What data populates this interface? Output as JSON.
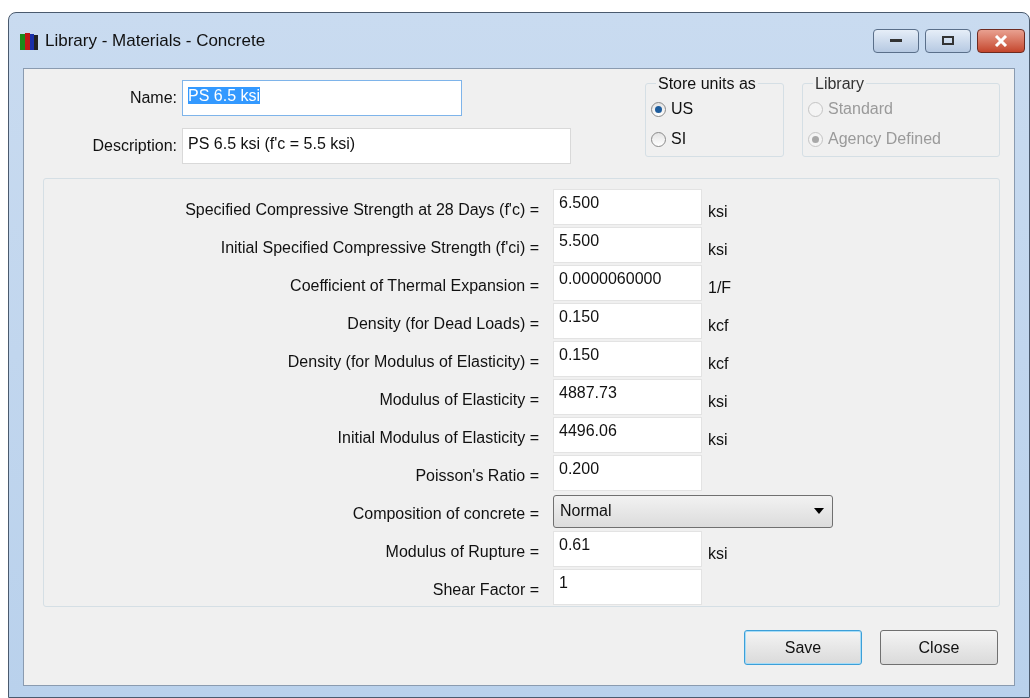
{
  "window": {
    "title": "Library - Materials - Concrete"
  },
  "header_fields": [
    {
      "label": "Name:",
      "value": "PS 6.5 ksi",
      "text_highlighted": true,
      "focused": true
    },
    {
      "label": "Description:",
      "value": "PS 6.5 ksi (f'c = 5.5 ksi)",
      "text_highlighted": false,
      "focused": false
    }
  ],
  "store_units": {
    "title": "Store units as",
    "options": [
      {
        "label": "US",
        "selected": true,
        "disabled": false
      },
      {
        "label": "SI",
        "selected": false,
        "disabled": false
      }
    ]
  },
  "library": {
    "title": "Library",
    "options": [
      {
        "label": "Standard",
        "selected": false,
        "disabled": true
      },
      {
        "label": "Agency Defined",
        "selected": true,
        "disabled": true
      }
    ]
  },
  "properties": [
    {
      "kind": "text",
      "label": "Specified Compressive Strength at 28 Days (f'c) =",
      "value": "6.500",
      "unit": "ksi"
    },
    {
      "kind": "text",
      "label": "Initial Specified Compressive Strength (f'ci) =",
      "value": "5.500",
      "unit": "ksi"
    },
    {
      "kind": "text",
      "label": "Coefficient of Thermal Expansion =",
      "value": "0.0000060000",
      "unit": "1/F"
    },
    {
      "kind": "text",
      "label": "Density (for Dead Loads) =",
      "value": "0.150",
      "unit": "kcf"
    },
    {
      "kind": "text",
      "label": "Density (for Modulus of Elasticity) =",
      "value": "0.150",
      "unit": "kcf"
    },
    {
      "kind": "text",
      "label": "Modulus of Elasticity =",
      "value": "4887.73",
      "unit": "ksi"
    },
    {
      "kind": "text",
      "label": "Initial Modulus of Elasticity =",
      "value": "4496.06",
      "unit": "ksi"
    },
    {
      "kind": "text",
      "label": "Poisson's Ratio =",
      "value": "0.200"
    },
    {
      "kind": "dropdown",
      "label": "Composition of concrete =",
      "value": "Normal"
    },
    {
      "kind": "text",
      "label": "Modulus of Rupture =",
      "value": "0.61",
      "unit": "ksi"
    },
    {
      "kind": "text",
      "label": "Shear Factor =",
      "value": "1"
    }
  ],
  "buttons": [
    {
      "label": "Save",
      "default": true
    },
    {
      "label": "Close",
      "default": false
    }
  ]
}
